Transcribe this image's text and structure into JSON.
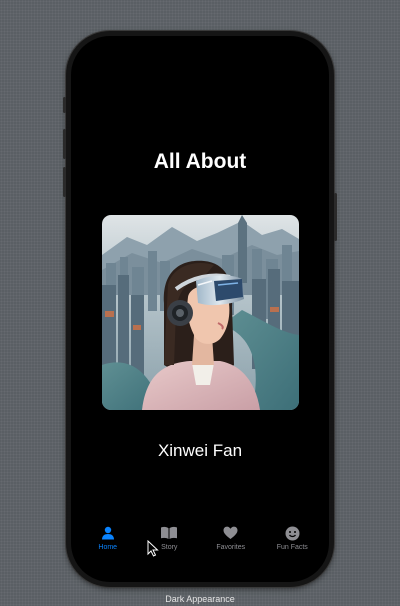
{
  "screen": {
    "title": "All About",
    "name": "Xinwei Fan",
    "portrait_image": "woman-wearing-vr-headset-over-city"
  },
  "tabs": [
    {
      "label": "Home",
      "icon": "person-icon",
      "selected": true
    },
    {
      "label": "Story",
      "icon": "book-icon",
      "selected": false
    },
    {
      "label": "Favorites",
      "icon": "heart-icon",
      "selected": false
    },
    {
      "label": "Fun Facts",
      "icon": "smiley-icon",
      "selected": false
    }
  ],
  "caption": "Dark Appearance",
  "colors": {
    "accent": "#0a84ff",
    "inactive_tab": "#8e8e93",
    "screen_background": "#000000",
    "backdrop": "#5a5f64"
  }
}
